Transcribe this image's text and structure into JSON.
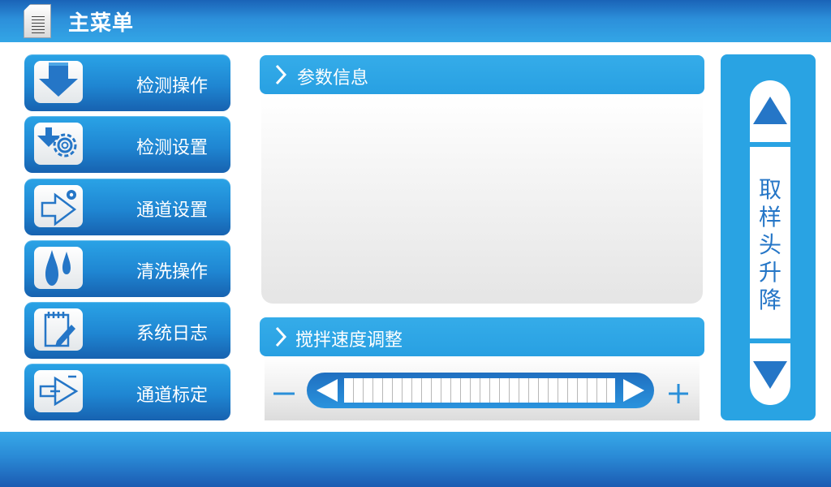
{
  "header": {
    "title": "主菜单",
    "icon": "document-icon"
  },
  "menu": [
    {
      "label": "检测操作",
      "icon": "arrow-down-icon"
    },
    {
      "label": "检测设置",
      "icon": "gear-download-icon"
    },
    {
      "label": "通道设置",
      "icon": "arrow-gear-icon"
    },
    {
      "label": "清洗操作",
      "icon": "water-drops-icon"
    },
    {
      "label": "系统日志",
      "icon": "notepad-edit-icon"
    },
    {
      "label": "通道标定",
      "icon": "arrow-plus-icon"
    }
  ],
  "params": {
    "title": "参数信息"
  },
  "stir": {
    "title": "搅拌速度调整",
    "minus": "−",
    "plus": "+"
  },
  "lift": {
    "chars": [
      "取",
      "样",
      "头",
      "升",
      "降"
    ]
  },
  "colors": {
    "accent": "#29a3e3",
    "dark": "#1762b0",
    "icon": "#2576c7"
  }
}
